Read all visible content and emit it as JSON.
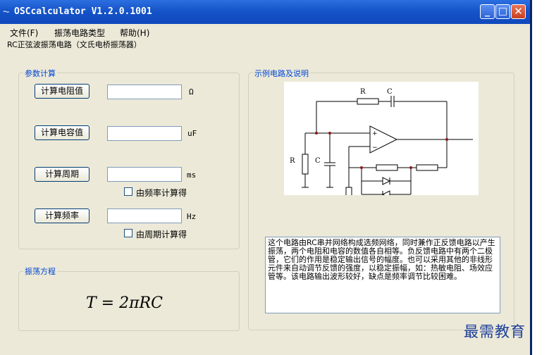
{
  "window": {
    "icon": "wave-icon",
    "title": "OSCcalculator V1.2.0.1001",
    "controls": {
      "minimize": "_",
      "maximize": "□",
      "close": "✕"
    }
  },
  "menu": {
    "items": [
      {
        "label": "文件(F)"
      },
      {
        "label": "振荡电路类型"
      },
      {
        "label": "帮助(H)"
      }
    ]
  },
  "subtitle": "RC正弦波振荡电路（文氏电桥振荡器）",
  "params": {
    "title": "参数计算",
    "rows": [
      {
        "button": "计算电阻值",
        "value": "",
        "unit": "Ω"
      },
      {
        "button": "计算电容值",
        "value": "",
        "unit": "uF"
      },
      {
        "button": "计算周期",
        "value": "",
        "unit": "ms",
        "checkbox": "由频率计算得",
        "checked": false
      },
      {
        "button": "计算频率",
        "value": "",
        "unit": "Hz",
        "checkbox": "由周期计算得",
        "checked": false
      }
    ]
  },
  "equation": {
    "title": "振荡方程",
    "formula": "T = 2πRC"
  },
  "example": {
    "title": "示例电路及说明",
    "circuit_labels": {
      "r_top": "R",
      "c_top": "C",
      "r_left": "R",
      "c_left": "C",
      "plus": "+",
      "minus": "−"
    },
    "description": "这个电路由RC串并网络构成选频网络，同时兼作正反馈电路以产生振荡，两个电阻和电容的数值各自相等。负反馈电路中有两个二极管，它们的作用是稳定输出信号的幅度。也可以采用其他的非线形元件来自动调节反馈的强度，以稳定振幅，如：热敏电阻、场效应管等。该电路输出波形较好，缺点是频率调节比较困难。"
  },
  "watermark": "最需教育",
  "colors": {
    "titlebar": "#1554c9",
    "group_label": "#0046d5",
    "window_bg": "#ece9d8"
  }
}
